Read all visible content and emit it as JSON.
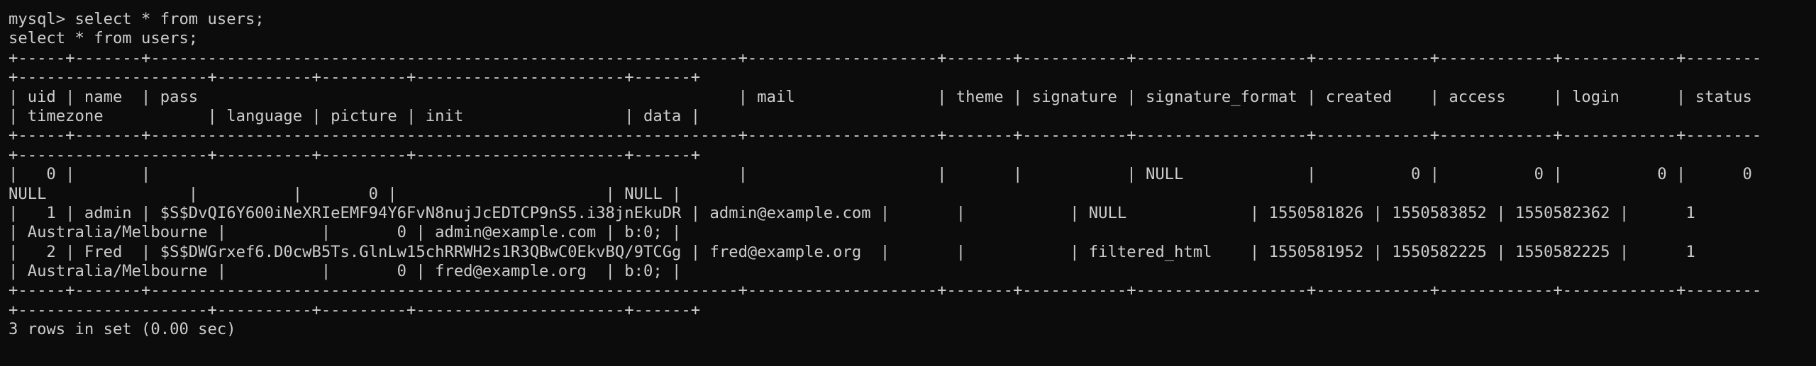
{
  "terminal": {
    "lines": [
      "mysql> select * from users;",
      "select * from users;",
      "+-----+-------+--------------------------------------------------------------+--------------------+-------+-----------+------------------+------------+------------+------------+--------",
      "+--------------------+----------+---------+----------------------+------+",
      "| uid | name  | pass                                                         | mail               | theme | signature | signature_format | created    | access     | login      | status",
      "| timezone           | language | picture | init                 | data |",
      "+-----+-------+--------------------------------------------------------------+--------------------+-------+-----------+------------------+------------+------------+------------+--------",
      "+--------------------+----------+---------+----------------------+------+",
      "|   0 |       |                                                              |                    |       |           | NULL             |          0 |          0 |          0 |      0",
      "NULL               |          |       0 |                      | NULL |",
      "|   1 | admin | $S$DvQI6Y600iNeXRIeEMF94Y6FvN8nujJcEDTCP9nS5.i38jnEkuDR | admin@example.com |       |           | NULL             | 1550581826 | 1550583852 | 1550582362 |      1",
      "| Australia/Melbourne |          |       0 | admin@example.com | b:0; |",
      "|   2 | Fred  | $S$DWGrxef6.D0cwB5Ts.GlnLw15chRRWH2s1R3QBwC0EkvBQ/9TCGg | fred@example.org  |       |           | filtered_html    | 1550581952 | 1550582225 | 1550582225 |      1",
      "| Australia/Melbourne |          |       0 | fred@example.org  | b:0; |",
      "+-----+-------+--------------------------------------------------------------+--------------------+-------+-----------+------------------+------------+------------+------------+--------",
      "+--------------------+----------+---------+----------------------+------+",
      "3 rows in set (0.00 sec)"
    ]
  }
}
